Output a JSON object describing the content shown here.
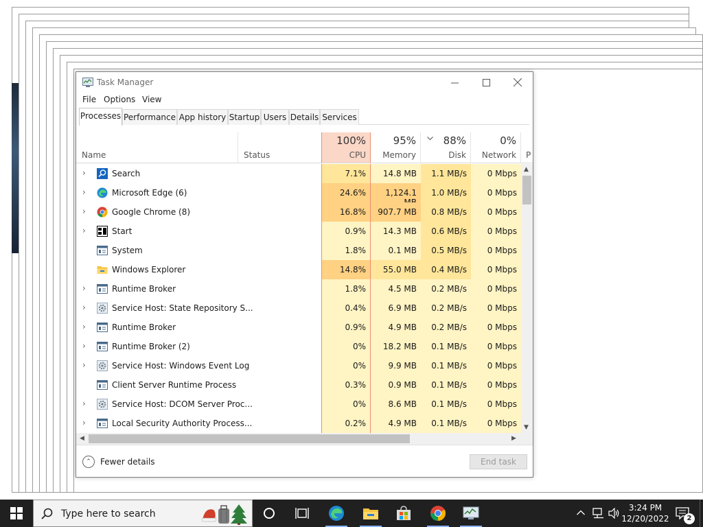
{
  "window": {
    "title": "Task Manager",
    "menu": [
      "File",
      "Options",
      "View"
    ],
    "tabs": [
      "Processes",
      "Performance",
      "App history",
      "Startup",
      "Users",
      "Details",
      "Services"
    ],
    "active_tab": "Processes"
  },
  "columns": {
    "name": "Name",
    "status": "Status",
    "cpu": {
      "pct": "100%",
      "label": "CPU"
    },
    "memory": {
      "pct": "95%",
      "label": "Memory"
    },
    "disk": {
      "pct": "88%",
      "label": "Disk"
    },
    "network": {
      "pct": "0%",
      "label": "Network"
    },
    "power_partial": "P"
  },
  "processes": [
    {
      "name": "Search",
      "expandable": true,
      "icon": "search-icon",
      "cpu": "7.1%",
      "memory": "14.8 MB",
      "disk": "1.1 MB/s",
      "network": "0 Mbps"
    },
    {
      "name": "Microsoft Edge (6)",
      "expandable": true,
      "icon": "edge-icon",
      "cpu": "24.6%",
      "memory": "1,124.1 MB",
      "disk": "1.0 MB/s",
      "network": "0 Mbps"
    },
    {
      "name": "Google Chrome (8)",
      "expandable": true,
      "icon": "chrome-icon",
      "cpu": "16.8%",
      "memory": "907.7 MB",
      "disk": "0.8 MB/s",
      "network": "0 Mbps"
    },
    {
      "name": "Start",
      "expandable": true,
      "icon": "start-icon",
      "cpu": "0.9%",
      "memory": "14.3 MB",
      "disk": "0.6 MB/s",
      "network": "0 Mbps"
    },
    {
      "name": "System",
      "expandable": false,
      "icon": "app-window-icon",
      "cpu": "1.8%",
      "memory": "0.1 MB",
      "disk": "0.5 MB/s",
      "network": "0 Mbps"
    },
    {
      "name": "Windows Explorer",
      "expandable": false,
      "icon": "folder-icon",
      "cpu": "14.8%",
      "memory": "55.0 MB",
      "disk": "0.4 MB/s",
      "network": "0 Mbps"
    },
    {
      "name": "Runtime Broker",
      "expandable": true,
      "icon": "app-window-icon",
      "cpu": "1.8%",
      "memory": "4.5 MB",
      "disk": "0.2 MB/s",
      "network": "0 Mbps"
    },
    {
      "name": "Service Host: State Repository S...",
      "expandable": true,
      "icon": "gear-icon",
      "cpu": "0.4%",
      "memory": "6.9 MB",
      "disk": "0.2 MB/s",
      "network": "0 Mbps"
    },
    {
      "name": "Runtime Broker",
      "expandable": true,
      "icon": "app-window-icon",
      "cpu": "0.9%",
      "memory": "4.9 MB",
      "disk": "0.2 MB/s",
      "network": "0 Mbps"
    },
    {
      "name": "Runtime Broker (2)",
      "expandable": true,
      "icon": "app-window-icon",
      "cpu": "0%",
      "memory": "18.2 MB",
      "disk": "0.1 MB/s",
      "network": "0 Mbps"
    },
    {
      "name": "Service Host: Windows Event Log",
      "expandable": true,
      "icon": "gear-icon",
      "cpu": "0%",
      "memory": "9.9 MB",
      "disk": "0.1 MB/s",
      "network": "0 Mbps"
    },
    {
      "name": "Client Server Runtime Process",
      "expandable": false,
      "icon": "app-window-icon",
      "cpu": "0.3%",
      "memory": "0.9 MB",
      "disk": "0.1 MB/s",
      "network": "0 Mbps"
    },
    {
      "name": "Service Host: DCOM Server Proc...",
      "expandable": true,
      "icon": "gear-icon",
      "cpu": "0%",
      "memory": "8.6 MB",
      "disk": "0.1 MB/s",
      "network": "0 Mbps"
    },
    {
      "name": "Local Security Authority Process...",
      "expandable": true,
      "icon": "app-window-icon",
      "cpu": "0.2%",
      "memory": "4.9 MB",
      "disk": "0.1 MB/s",
      "network": "0 Mbps"
    }
  ],
  "footer": {
    "fewer_details": "Fewer details",
    "end_task": "End task"
  },
  "taskbar": {
    "search_placeholder": "Type here to search",
    "time": "3:24 PM",
    "date": "12/20/2022",
    "notification_count": "2"
  },
  "colors": {
    "cpu_header": "#fbd7c8",
    "heat_low": "#fff4c4",
    "heat_mid": "#ffe69a",
    "heat_high": "#ffd183",
    "taskbar": "#202020"
  }
}
